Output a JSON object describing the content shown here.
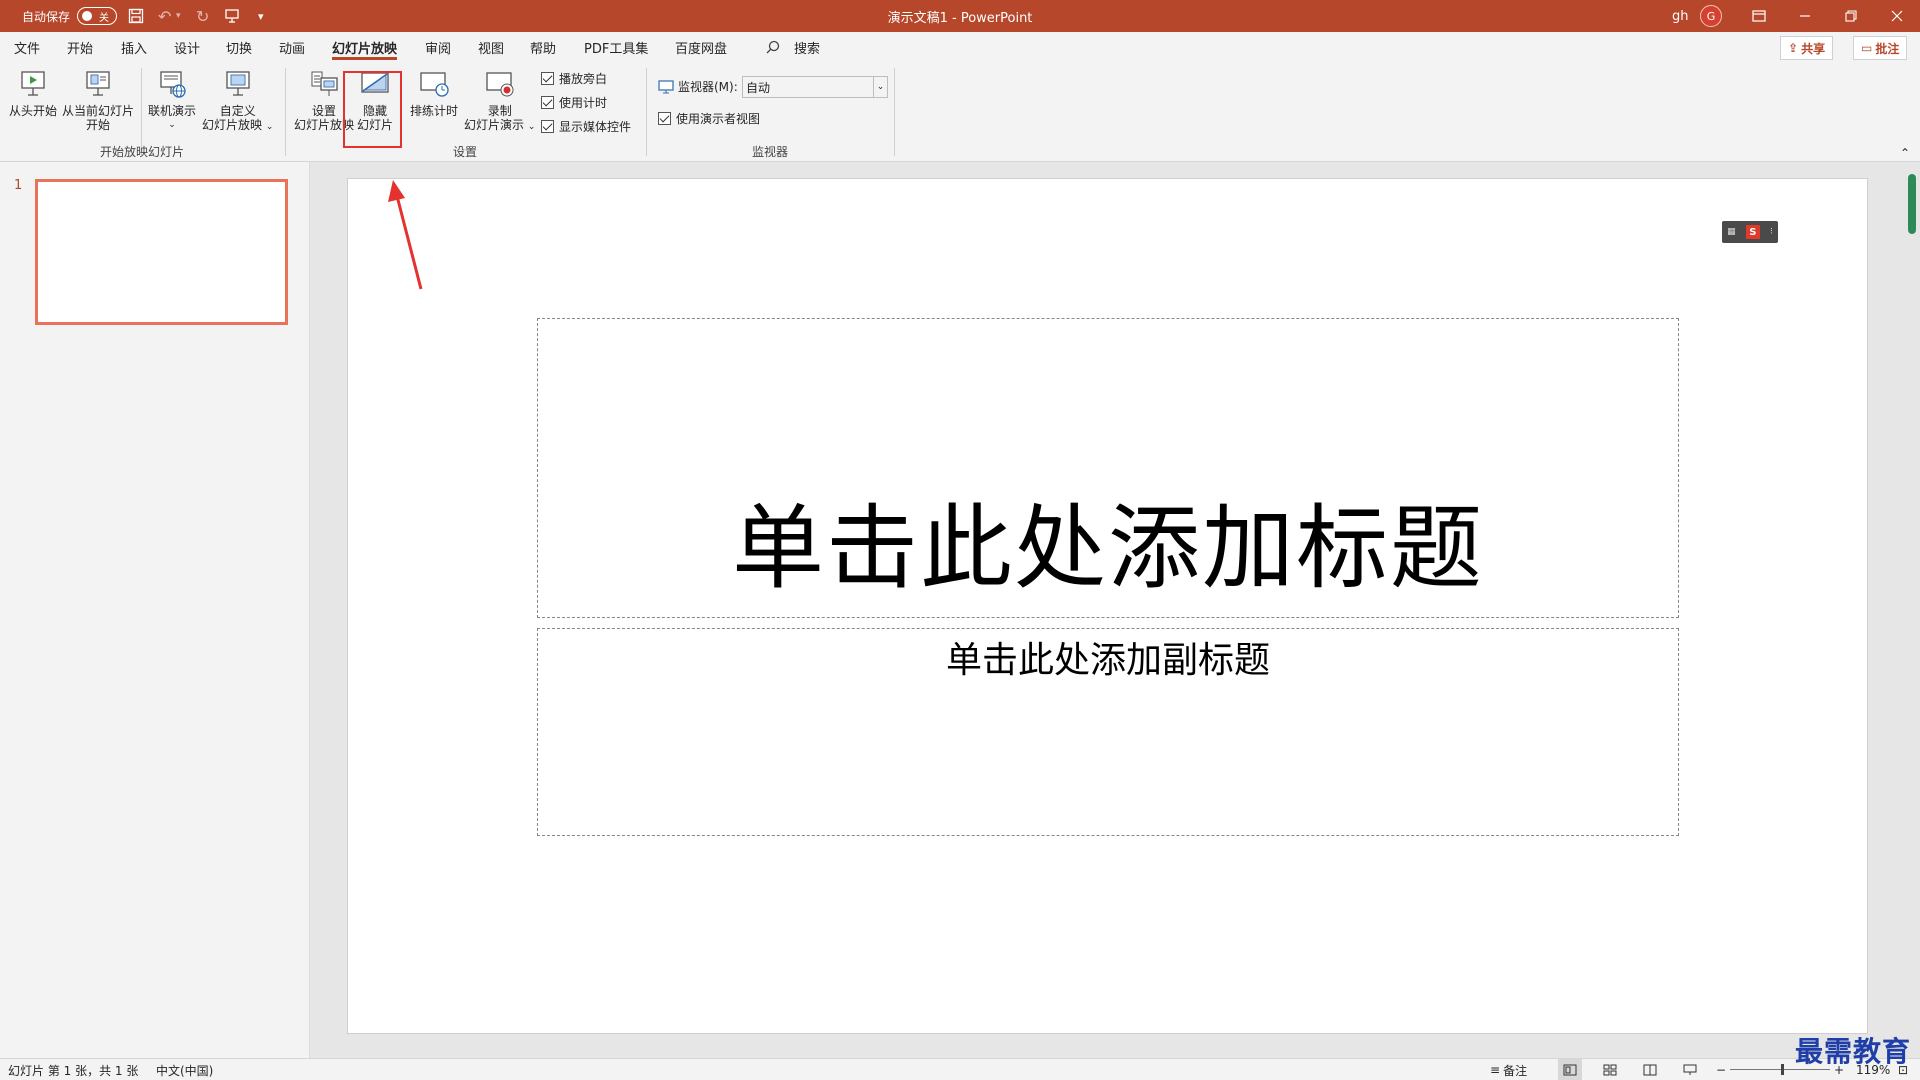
{
  "titlebar": {
    "autosave_label": "自动保存",
    "autosave_state": "关",
    "doc_title": "演示文稿1  -  PowerPoint",
    "user_name": "gh",
    "user_initial": "G",
    "accent_color": "#b7472a"
  },
  "tabs": [
    "文件",
    "开始",
    "插入",
    "设计",
    "切换",
    "动画",
    "幻灯片放映",
    "审阅",
    "视图",
    "帮助",
    "PDF工具集",
    "百度网盘"
  ],
  "active_tab": "幻灯片放映",
  "search_label": "搜索",
  "share_label": "共享",
  "comment_label": "批注",
  "ribbon": {
    "start_group": {
      "label": "开始放映幻灯片",
      "from_beginning": "从头开始",
      "from_current_1": "从当前幻灯片",
      "from_current_2": "开始",
      "online_present": "联机演示",
      "custom_1": "自定义",
      "custom_2": "幻灯片放映"
    },
    "setup_group": {
      "label": "设置",
      "setup_1": "设置",
      "setup_2": "幻灯片放映",
      "hide_1": "隐藏",
      "hide_2": "幻灯片",
      "rehearse": "排练计时",
      "record_1": "录制",
      "record_2": "幻灯片演示",
      "play_narrations": "播放旁白",
      "use_timings": "使用计时",
      "show_media_controls": "显示媒体控件"
    },
    "monitors_group": {
      "label": "监视器",
      "monitor_label": "监视器(M):",
      "monitor_value": "自动",
      "presenter_view": "使用演示者视图"
    }
  },
  "thumbnails": {
    "slide_number": "1"
  },
  "slide": {
    "title_placeholder": "单击此处添加标题",
    "subtitle_placeholder": "单击此处添加副标题"
  },
  "statusbar": {
    "slide_info": "幻灯片 第 1 张，共 1 张",
    "language": "中文(中国)",
    "notes_label": "备注",
    "zoom_out": "−",
    "zoom_in": "+",
    "zoom_level": "119%"
  },
  "watermark": "最需教育"
}
